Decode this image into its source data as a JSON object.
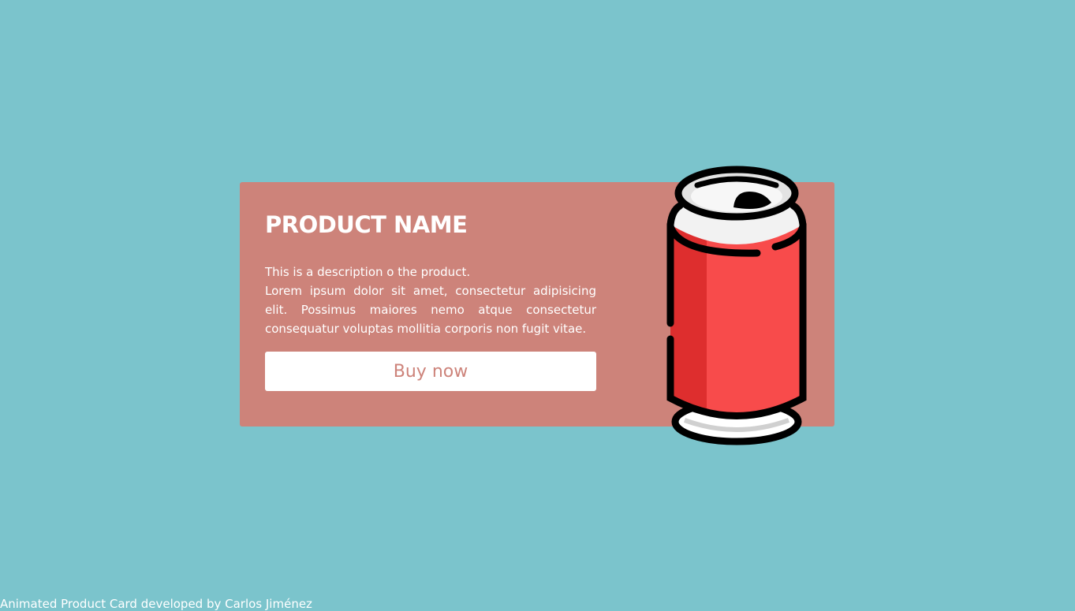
{
  "card": {
    "title": "PRODUCT NAME",
    "description_intro": "This is a description o the product.",
    "description_body": "Lorem ipsum dolor sit amet, consectetur adipisicing elit. Possimus maiores nemo atque consectetur consequatur voluptas mollitia corporis non fugit vitae.",
    "button_label": "Buy now",
    "image_icon": "soda-can-icon"
  },
  "footer": {
    "credit": "Animated Product Card developed by Carlos Jiménez"
  },
  "colors": {
    "background": "#7bc4cc",
    "card": "#cd837a",
    "button": "#ffffff",
    "button_text": "#cd837a",
    "can_red": "#f84b4b",
    "can_dark_red": "#de2e2e"
  }
}
